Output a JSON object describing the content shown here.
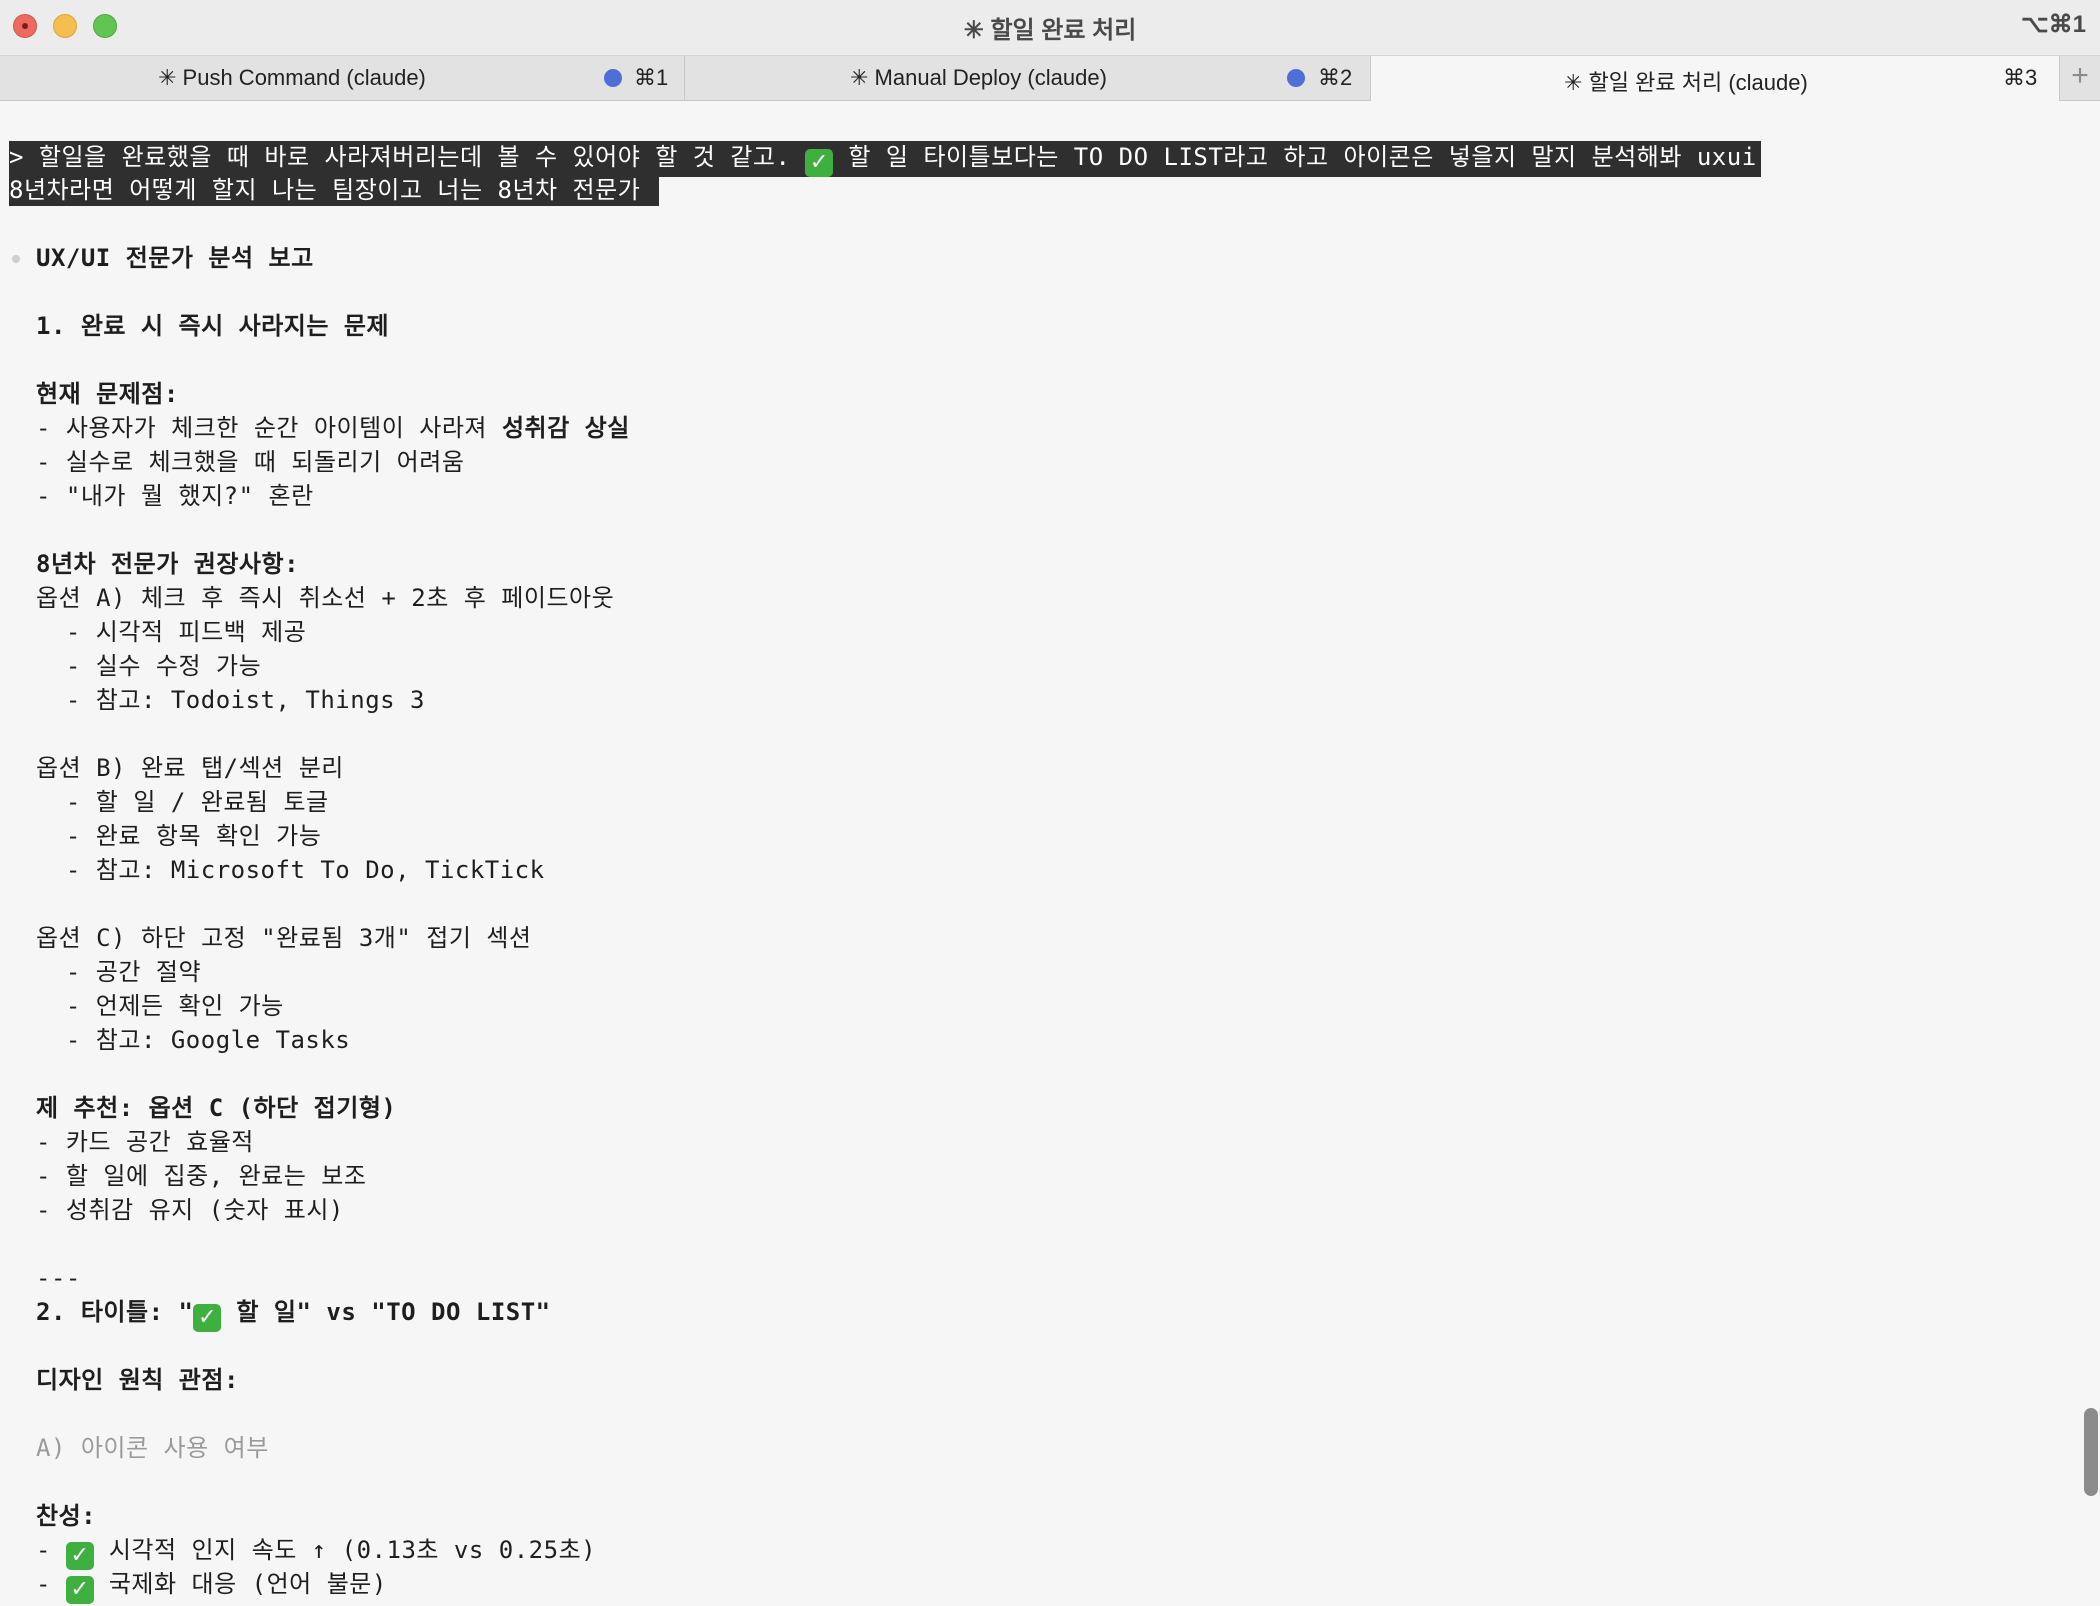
{
  "window": {
    "title": "✳ 할일 완료 처리",
    "shortcut": "⌥⌘1"
  },
  "tabs": [
    {
      "label": "✳ Push Command (claude)",
      "shortcut": "⌘1",
      "has_dot": true
    },
    {
      "label": "✳ Manual Deploy (claude)",
      "shortcut": "⌘2",
      "has_dot": true
    },
    {
      "label": "✳ 할일 완료 처리 (claude)",
      "shortcut": "⌘3",
      "has_dot": false
    }
  ],
  "add_tab_label": "+",
  "prompt": {
    "line1_prefix": "> 할일을 완료했을 때 바로 사라져버리는데 볼 수 있어야 할 것 같고. ",
    "check_icon": "✓",
    "line1_suffix": " 할 일 타이틀보다는 TO DO LIST라고 하고 아이콘은 넣을지 말지 분석해봐 uxui",
    "line2": "8년차라면 어떻게 할지 나는 팀장이고 너는 8년차 전문가 "
  },
  "report": {
    "heading": "UX/UI 전문가 분석 보고",
    "section1_title": "1. 완료 시 즉시 사라지는 문제",
    "current_problems_title": "현재 문제점:",
    "problem1_prefix": "- 사용자가 체크한 순간 아이템이 사라져 ",
    "problem1_bold": "성취감 상실",
    "problem2": "- 실수로 체크했을 때 되돌리기 어려움",
    "problem3": "- \"내가 뭘 했지?\" 혼란",
    "recommend_title": "8년차 전문가 권장사항:",
    "optionA": "옵션 A) 체크 후 즉시 취소선 + 2초 후 페이드아웃",
    "optionA_1": "  - 시각적 피드백 제공",
    "optionA_2": "  - 실수 수정 가능",
    "optionA_3": "  - 참고: Todoist, Things 3",
    "optionB": "옵션 B) 완료 탭/섹션 분리",
    "optionB_1": "  - 할 일 / 완료됨 토글",
    "optionB_2": "  - 완료 항목 확인 가능",
    "optionB_3": "  - 참고: Microsoft To Do, TickTick",
    "optionC": "옵션 C) 하단 고정 \"완료됨 3개\" 접기 섹션",
    "optionC_1": "  - 공간 절약",
    "optionC_2": "  - 언제든 확인 가능",
    "optionC_3": "  - 참고: Google Tasks",
    "my_pick": "제 추천: 옵션 C (하단 접기형)",
    "pick_1": "- 카드 공간 효율적",
    "pick_2": "- 할 일에 집중, 완료는 보조",
    "pick_3": "- 성취감 유지 (숫자 표시)",
    "divider": "---",
    "section2_prefix": "2. 타이틀: \"",
    "section2_suffix": " 할 일\" vs \"TO DO LIST\"",
    "design_title": "디자인 원칙 관점:",
    "icon_usage": "A) 아이콘 사용 여부",
    "pro_title": "찬성:",
    "pro_1": " 시각적 인지 속도 ↑ (0.13초 vs 0.25초)",
    "pro_2": " 국제화 대응 (언어 불문)",
    "dash": "- "
  }
}
